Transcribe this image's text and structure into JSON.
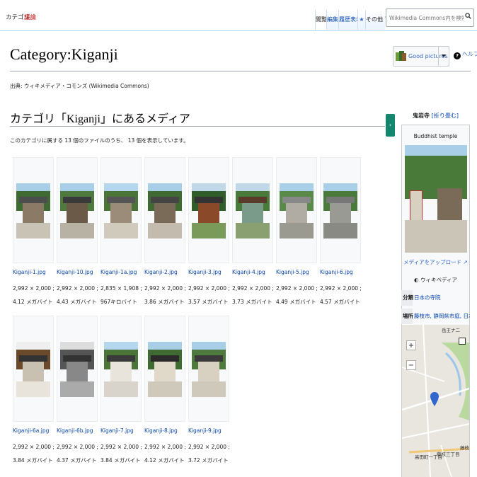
{
  "top": {
    "tab_category": "カテゴリ",
    "tab_talk": "議論",
    "tab_view": "閲覧",
    "tab_edit": "編集",
    "tab_history": "履歴表示",
    "tab_more": "その他",
    "search_placeholder": "Wikimedia Commons内を検索"
  },
  "page": {
    "title": "Category:Kiganji",
    "good_pictures": "Good pictures",
    "help": "ヘルプ",
    "source": "出典: ウィキメディア・コモンズ (Wikimedia Commons)",
    "media_heading": "カテゴリ「Kiganji」にあるメディア",
    "count_text": "このカテゴリに属する 13 個のファイルのうち、 13 個を表示しています。"
  },
  "files": [
    {
      "name": "Kiganji-1.jpg",
      "meta": "2,992 × 2,000 ; 4.12 メガバイト"
    },
    {
      "name": "Kiganji-10.jpg",
      "meta": "2,992 × 2,000 ; 4.43 メガバイト"
    },
    {
      "name": "Kiganji-1a.jpg",
      "meta": "2,835 × 1,908 ; 967キロバイト"
    },
    {
      "name": "Kiganji-2.jpg",
      "meta": "2,992 × 2,000 ; 3.86 メガバイト"
    },
    {
      "name": "Kiganji-3.jpg",
      "meta": "2,992 × 2,000 ; 3.57 メガバイト"
    },
    {
      "name": "Kiganji-4.jpg",
      "meta": "2,992 × 2,000 ; 3.73 メガバイト"
    },
    {
      "name": "Kiganji-5.jpg",
      "meta": "2,992 × 2,000 ; 4.49 メガバイト"
    },
    {
      "name": "Kiganji-6.jpg",
      "meta": "2,992 × 2,000 ; 4.57 メガバイト"
    },
    {
      "name": "Kiganji-6a.jpg",
      "meta": "2,992 × 2,000 ; 3.84 メガバイト"
    },
    {
      "name": "Kiganji-6b.jpg",
      "meta": "2,992 × 2,000 ; 4.37 メガバイト"
    },
    {
      "name": "Kiganji-7.jpg",
      "meta": "2,992 × 2,000 ; 3.84 メガバイト"
    },
    {
      "name": "Kiganji-8.jpg",
      "meta": "2,992 × 2,000 ; 4.12 メガバイト"
    },
    {
      "name": "Kiganji-9.jpg",
      "meta": "2,992 × 2,000 ; 3.72 メガバイト"
    }
  ],
  "infobox": {
    "title": "鬼岩寺",
    "collapse": "[折り畳む]",
    "subtitle": "Buddhist temple",
    "upload": "メディアをアップロード",
    "wikipedia": "ウィキペディア",
    "row1_key": "分類",
    "row1_val": "日本の寺院",
    "row2_key": "場所",
    "row2_val": "藤枝市, 静岡県市庭, 日本",
    "map_label_1": "高田町一丁目",
    "map_label_2": "藤枝三丁目",
    "map_label_3": "藤枝",
    "map_label_4": "岳王ナ二"
  },
  "colors": {
    "link": "#0645ad",
    "accent": "#14866d"
  }
}
